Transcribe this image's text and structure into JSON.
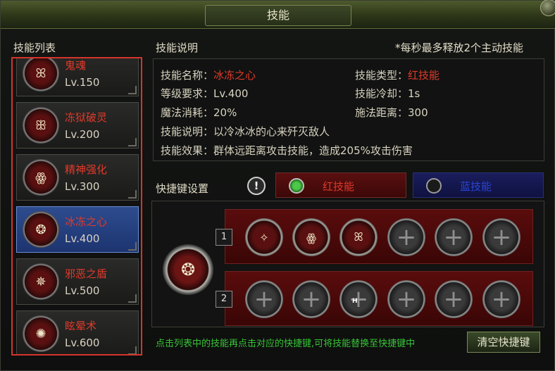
{
  "window": {
    "title": "技能"
  },
  "skill_list": {
    "title": "技能列表",
    "items": [
      {
        "name": "鬼魂",
        "level": "Lv.150",
        "icon": "ghost-skill-icon",
        "glyph": "ꕤ",
        "active": false
      },
      {
        "name": "冻狱破灵",
        "level": "Lv.200",
        "icon": "frost-prison-skill-icon",
        "glyph": "ꕥ",
        "active": false
      },
      {
        "name": "精神强化",
        "level": "Lv.300",
        "icon": "spirit-boost-skill-icon",
        "glyph": "ꙮ",
        "active": false
      },
      {
        "name": "冰冻之心",
        "level": "Lv.400",
        "icon": "frozen-heart-skill-icon",
        "glyph": "❂",
        "active": true
      },
      {
        "name": "邪恶之盾",
        "level": "Lv.500",
        "icon": "evil-shield-skill-icon",
        "glyph": "✵",
        "active": false
      },
      {
        "name": "眩晕术",
        "level": "Lv.600",
        "icon": "stun-skill-icon",
        "glyph": "✺",
        "active": false
      }
    ]
  },
  "description": {
    "title": "技能说明",
    "note": "*每秒最多释放2个主动技能",
    "name_label": "技能名称：",
    "name_value": "冰冻之心",
    "type_label": "技能类型：",
    "type_value": "红技能",
    "level_req": "等级要求：Lv.400",
    "cooldown": "技能冷却：1s",
    "mana_cost": "魔法消耗：20%",
    "cast_range": "施法距离：300",
    "desc": "技能说明：以冷冰冰的心来歼灭敌人",
    "effect": "技能效果：群体远距离攻击技能，造成205%攻击伤害"
  },
  "hotkey": {
    "title": "快捷键设置",
    "red_option": "红技能",
    "blue_option": "蓝技能",
    "selected": "red",
    "row1_label": "1",
    "row2_label": "2",
    "row1_slots": [
      "filled",
      "filled",
      "filled",
      "empty",
      "empty",
      "empty"
    ],
    "row2_slots": [
      "empty",
      "empty",
      "empty",
      "empty",
      "empty",
      "empty"
    ],
    "slot_hotkey_mark": "H",
    "hint": "点击列表中的技能再点击对应的快捷键,可将技能替换至快捷键中",
    "clear_button": "清空快捷键"
  },
  "colors": {
    "accent_red": "#e03a2a",
    "hint_green": "#37c437",
    "active_blue": "#2d4c8e"
  }
}
